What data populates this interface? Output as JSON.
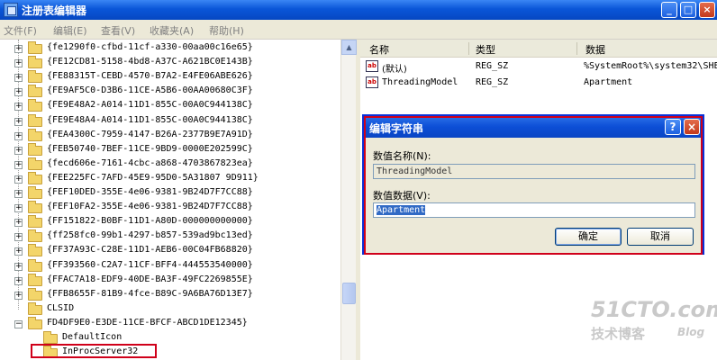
{
  "window": {
    "title": "注册表编辑器",
    "min": "_",
    "max": "□",
    "close": "×"
  },
  "menu": [
    "文件(F)",
    "编辑(E)",
    "查看(V)",
    "收藏夹(A)",
    "帮助(H)"
  ],
  "tree": {
    "items": [
      "{fe1290f0-cfbd-11cf-a330-00aa00c16e65}",
      "{FE12CD81-5158-4bd8-A37C-A621BC0E143B}",
      "{FE88315T-CEBD-4570-B7A2-E4FE06ABE626}",
      "{FE9AF5C0-D3B6-11CE-A5B6-00AA00680C3F}",
      "{FE9E48A2-A014-11D1-855C-00A0C944138C}",
      "{FE9E48A4-A014-11D1-855C-00A0C944138C}",
      "{FEA4300C-7959-4147-B26A-2377B9E7A91D}",
      "{FEB50740-7BEF-11CE-9BD9-0000E202599C}",
      "{fecd606e-7161-4cbc-a868-4703867823ea}",
      "{FEE225FC-7AFD-45E9-95D0-5A31807 9D911}",
      "{FEF10DED-355E-4e06-9381-9B24D7F7CC88}",
      "{FEF10FA2-355E-4e06-9381-9B24D7F7CC88}",
      "{FF151822-B0BF-11D1-A80D-000000000000}",
      "{ff258fc0-99b1-4297-b857-539ad9bc13ed}",
      "{FF37A93C-C28E-11D1-AEB6-00C04FB68820}",
      "{FF393560-C2A7-11CF-BFF4-444553540000}",
      "{FFAC7A18-EDF9-40DE-BA3F-49FC2269855E}",
      "{FFB8655F-81B9-4fce-B89C-9A6BA76D13E7}"
    ],
    "clsid": "CLSID",
    "expanded": "FD4DF9E0-E3DE-11CE-BFCF-ABCD1DE12345}",
    "child1": "DefaultIcon",
    "child2": "InProcServer32"
  },
  "list": {
    "columns": [
      "名称",
      "类型",
      "数据"
    ],
    "rows": [
      {
        "name": "(默认)",
        "type": "REG_SZ",
        "data": "%SystemRoot%\\system32\\SHE"
      },
      {
        "name": "ThreadingModel",
        "type": "REG_SZ",
        "data": "Apartment"
      }
    ]
  },
  "dialog": {
    "title": "编辑字符串",
    "help": "?",
    "close": "×",
    "name_label": "数值名称(N):",
    "name_value": "ThreadingModel",
    "data_label": "数值数据(V):",
    "data_value": "Apartment",
    "ok": "确定",
    "cancel": "取消"
  },
  "watermark": {
    "line1": "51CTO.com",
    "line2": "技术博客",
    "line3": "Blog"
  }
}
